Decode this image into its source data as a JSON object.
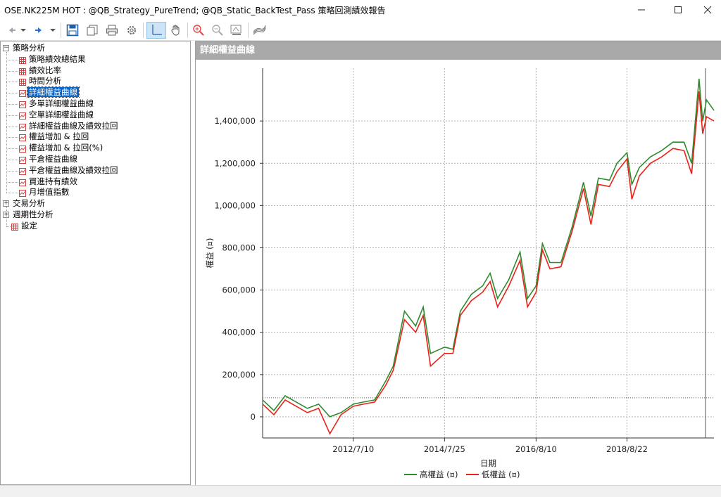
{
  "window": {
    "title": "OSE.NK225M HOT : @QB_Strategy_PureTrend; @QB_Static_BackTest_Pass 策略回測績效報告",
    "minimize_icon": "minimize-icon",
    "maximize_icon": "maximize-icon",
    "close_icon": "close-icon"
  },
  "toolbar": {
    "buttons": [
      "back-icon",
      "dropdown-icon",
      "forward-icon",
      "dropdown-icon",
      "save-icon",
      "copy-icon",
      "print-icon",
      "settings-icon",
      "crosshair-icon",
      "pan-hand-icon",
      "zoom-in-icon",
      "zoom-out-icon",
      "fit-zoom-icon",
      "chart-style-icon"
    ]
  },
  "tree": {
    "root_label": "策略分析",
    "children": [
      {
        "label": "策略績效總結果",
        "icon": "grid-icon"
      },
      {
        "label": "績效比率",
        "icon": "grid-icon"
      },
      {
        "label": "時間分析",
        "icon": "grid-icon"
      },
      {
        "label": "詳細權益曲線",
        "icon": "chart-icon",
        "selected": true
      },
      {
        "label": "多單詳細權益曲線",
        "icon": "chart-icon"
      },
      {
        "label": "空單詳細權益曲線",
        "icon": "chart-icon"
      },
      {
        "label": "詳細權益曲線及績效拉回",
        "icon": "chart-icon"
      },
      {
        "label": "權益增加 & 拉回",
        "icon": "chart-icon"
      },
      {
        "label": "權益增加 & 拉回(%)",
        "icon": "chart-icon"
      },
      {
        "label": "平倉權益曲線",
        "icon": "chart-icon"
      },
      {
        "label": "平倉權益曲線及績效拉回",
        "icon": "chart-icon"
      },
      {
        "label": "買進持有績效",
        "icon": "chart-icon"
      },
      {
        "label": "月增值指數",
        "icon": "chart-icon"
      }
    ],
    "other_nodes": [
      {
        "label": "交易分析",
        "expander": "+"
      },
      {
        "label": "週期性分析",
        "expander": "+"
      },
      {
        "label": "設定",
        "icon": "grid-icon"
      }
    ]
  },
  "panel": {
    "header": "詳細權益曲線"
  },
  "chart_data": {
    "type": "line",
    "ylabel": "權益 (¤)",
    "xlabel": "日期",
    "ylim": [
      -100000,
      1650000
    ],
    "yticks": [
      0,
      200000,
      400000,
      600000,
      800000,
      1000000,
      1200000,
      1400000
    ],
    "ytick_labels": [
      "0",
      "200,000",
      "400,000",
      "600,000",
      "800,000",
      "1,000,000",
      "1,200,000",
      "1,400,000"
    ],
    "xticks": [
      "2012/7/10",
      "2014/7/25",
      "2016/8/10",
      "2018/8/22"
    ],
    "x_range": [
      "2010/7/1",
      "2020/8/1"
    ],
    "grid": true,
    "legend_position": "bottom",
    "reference_line": 90000,
    "series": [
      {
        "name": "高權益 (¤)",
        "color": "#2e8b2e",
        "x": [
          "2010/7/1",
          "2010/10/1",
          "2011/1/1",
          "2011/4/1",
          "2011/7/1",
          "2011/10/1",
          "2012/1/1",
          "2012/4/1",
          "2012/7/10",
          "2012/10/1",
          "2013/1/1",
          "2013/4/1",
          "2013/6/1",
          "2013/9/1",
          "2013/12/1",
          "2014/2/1",
          "2014/4/1",
          "2014/7/25",
          "2014/10/1",
          "2014/12/1",
          "2015/3/1",
          "2015/6/1",
          "2015/8/1",
          "2015/10/1",
          "2016/1/1",
          "2016/4/1",
          "2016/6/1",
          "2016/8/10",
          "2016/10/1",
          "2016/12/1",
          "2017/3/1",
          "2017/6/1",
          "2017/9/1",
          "2017/11/1",
          "2018/1/1",
          "2018/4/1",
          "2018/6/1",
          "2018/8/22",
          "2018/10/1",
          "2018/12/1",
          "2019/3/1",
          "2019/6/1",
          "2019/9/1",
          "2019/12/1",
          "2020/2/1",
          "2020/4/1",
          "2020/5/1",
          "2020/6/1",
          "2020/8/1"
        ],
        "values": [
          80000,
          30000,
          100000,
          70000,
          40000,
          60000,
          0,
          20000,
          60000,
          70000,
          80000,
          170000,
          240000,
          500000,
          430000,
          520000,
          300000,
          330000,
          320000,
          500000,
          580000,
          620000,
          680000,
          560000,
          650000,
          780000,
          560000,
          620000,
          820000,
          730000,
          730000,
          900000,
          1110000,
          950000,
          1130000,
          1120000,
          1200000,
          1250000,
          1100000,
          1180000,
          1230000,
          1260000,
          1300000,
          1300000,
          1200000,
          1600000,
          1400000,
          1500000,
          1450000
        ]
      },
      {
        "name": "低權益 (¤)",
        "color": "#e8231a",
        "x": [
          "2010/7/1",
          "2010/10/1",
          "2011/1/1",
          "2011/4/1",
          "2011/7/1",
          "2011/10/1",
          "2012/1/1",
          "2012/4/1",
          "2012/7/10",
          "2012/10/1",
          "2013/1/1",
          "2013/4/1",
          "2013/6/1",
          "2013/9/1",
          "2013/12/1",
          "2014/2/1",
          "2014/4/1",
          "2014/7/25",
          "2014/10/1",
          "2014/12/1",
          "2015/3/1",
          "2015/6/1",
          "2015/8/1",
          "2015/10/1",
          "2016/1/1",
          "2016/4/1",
          "2016/6/1",
          "2016/8/10",
          "2016/10/1",
          "2016/12/1",
          "2017/3/1",
          "2017/6/1",
          "2017/9/1",
          "2017/11/1",
          "2018/1/1",
          "2018/4/1",
          "2018/6/1",
          "2018/8/22",
          "2018/10/1",
          "2018/12/1",
          "2019/3/1",
          "2019/6/1",
          "2019/9/1",
          "2019/12/1",
          "2020/2/1",
          "2020/4/1",
          "2020/5/1",
          "2020/6/1",
          "2020/8/1"
        ],
        "values": [
          60000,
          10000,
          80000,
          50000,
          20000,
          40000,
          -80000,
          10000,
          50000,
          60000,
          70000,
          150000,
          220000,
          460000,
          400000,
          480000,
          240000,
          300000,
          300000,
          480000,
          550000,
          590000,
          640000,
          520000,
          620000,
          740000,
          520000,
          590000,
          790000,
          700000,
          710000,
          880000,
          1080000,
          910000,
          1100000,
          1090000,
          1160000,
          1220000,
          1030000,
          1140000,
          1200000,
          1230000,
          1270000,
          1260000,
          1150000,
          1540000,
          1340000,
          1420000,
          1400000
        ]
      }
    ]
  }
}
